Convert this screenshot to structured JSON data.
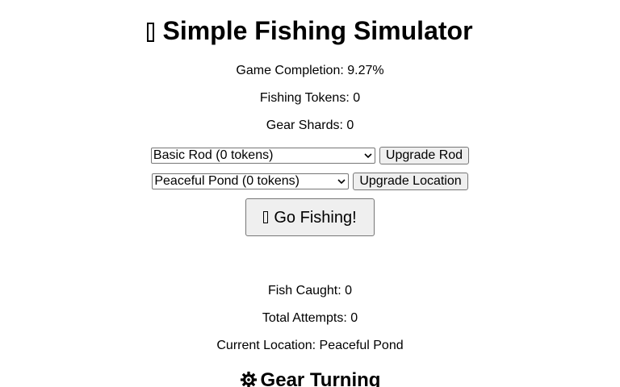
{
  "title": {
    "icon": "fish-emoji-icon",
    "text": "Simple Fishing Simulator"
  },
  "stats": {
    "completion": "Game Completion: 9.27%",
    "tokens": "Fishing Tokens: 0",
    "shards": "Gear Shards: 0"
  },
  "rod": {
    "selected": "Basic Rod (0 tokens)",
    "button": "Upgrade Rod"
  },
  "location": {
    "selected": "Peaceful Pond (0 tokens)",
    "button": "Upgrade Location"
  },
  "fish_button": {
    "icon": "fishing-pole-emoji-icon",
    "label": "Go Fishing!"
  },
  "results": {
    "caught": "Fish Caught: 0",
    "attempts": "Total Attempts: 0",
    "current_location": "Current Location: Peaceful Pond"
  },
  "gear_section": {
    "icon": "gear-icon",
    "heading": "Gear Turning"
  }
}
